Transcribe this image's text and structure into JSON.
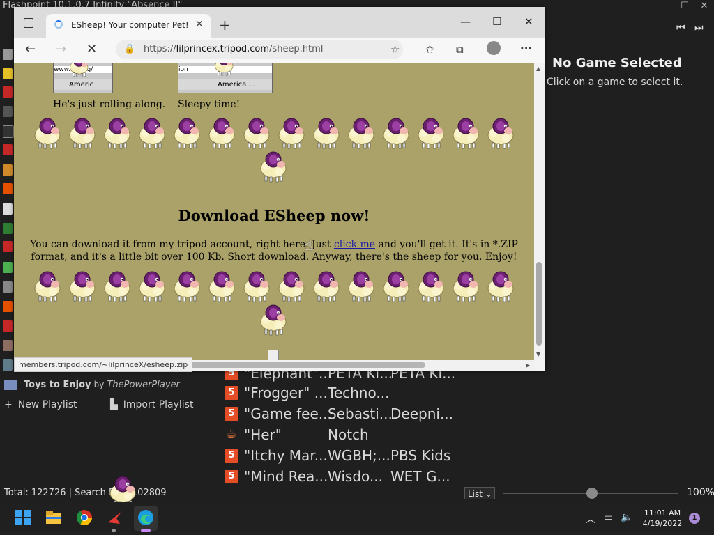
{
  "flashpoint": {
    "window_title": "Flashpoint 10.1.0.7 Infinity \"Absence II\"",
    "no_game_title": "No Game Selected",
    "no_game_subtitle": "Click on a game to select it.",
    "playlist_label": "Toys to Enjoy",
    "playlist_by": "by",
    "playlist_author": "ThePowerPlayer",
    "new_playlist": "New Playlist",
    "import_playlist": "Import Playlist",
    "games": [
      {
        "title": "\"Elephant\"...",
        "dev": "PETA Ki...",
        "pub": "PETA Ki...",
        "icon": "html5"
      },
      {
        "title": "\"Frogger\" ...",
        "dev": "Techno...",
        "pub": "",
        "icon": "html5"
      },
      {
        "title": "\"Game fee...",
        "dev": "Sebasti...",
        "pub": "Deepni...",
        "icon": "html5"
      },
      {
        "title": "\"Her\"",
        "dev": "Notch",
        "pub": "",
        "icon": "java"
      },
      {
        "title": "\"Itchy Mar...",
        "dev": "WGBH;...",
        "pub": "PBS Kids",
        "icon": "html5"
      },
      {
        "title": "\"Mind Rea...",
        "dev": "Wisdo...",
        "pub": "WET G...",
        "icon": "html5"
      }
    ],
    "status": "Total: 122726  |  Search Re... 102809",
    "view_mode": "List",
    "zoom": "100%"
  },
  "browser": {
    "tab_title": "ESheep! Your computer Pet!",
    "url_prefix": "https://",
    "url_host": "lilprincex.tripod.com",
    "url_path": "/sheep.html",
    "status_url": "members.tripod.com/~lilprinceX/esheep.zip"
  },
  "page": {
    "shot1_text1": "www.ng.org/",
    "shot1_text2": "Americ",
    "shot2_text1": "ion",
    "shot2_text2": "America ...",
    "caption1": "He's just rolling along.",
    "caption2": "Sleepy time!",
    "heading": "Download ESheep now!",
    "text_before_link": "You can download it from my tripod account, right here. Just ",
    "link_text": "click me",
    "text_after_link": " and you'll get it. It's in *.ZIP format, and it's a little bit over 100 Kb. Short download. Anyway, there's the sheep for you. Enjoy!"
  },
  "taskbar": {
    "time": "11:01 AM",
    "date": "4/19/2022",
    "notifications": "1"
  }
}
